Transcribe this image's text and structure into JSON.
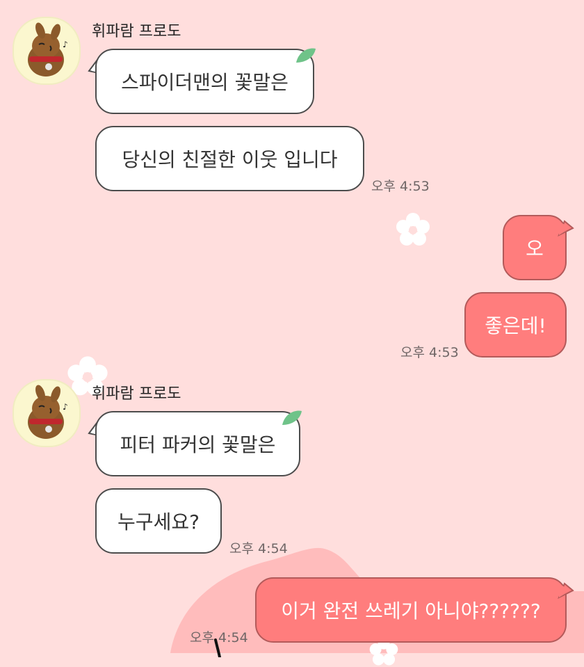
{
  "chat": {
    "messages": [
      {
        "sender": "휘파람 프로도",
        "text": "스파이더맨의 꽃말은"
      },
      {
        "text": "당신의 친절한 이웃 입니다",
        "time": "오후 4:53"
      },
      {
        "text": "오"
      },
      {
        "text": "좋은데!",
        "time": "오후 4:53"
      },
      {
        "sender": "휘파람 프로도",
        "text": "피터 파커의 꽃말은"
      },
      {
        "text": "누구세요?",
        "time": "오후 4:54"
      },
      {
        "text": "이거 완전 쓰레기 아니야??????",
        "time": "오후 4:54"
      }
    ]
  },
  "theme": {
    "background": "#ffdedd",
    "incoming_bubble": "#ffffff",
    "outgoing_bubble": "#ff7d7d",
    "leaf_color": "#6fc389"
  },
  "icons": [
    "profile-avatar-character",
    "leaf-icon",
    "flower-decoration"
  ]
}
